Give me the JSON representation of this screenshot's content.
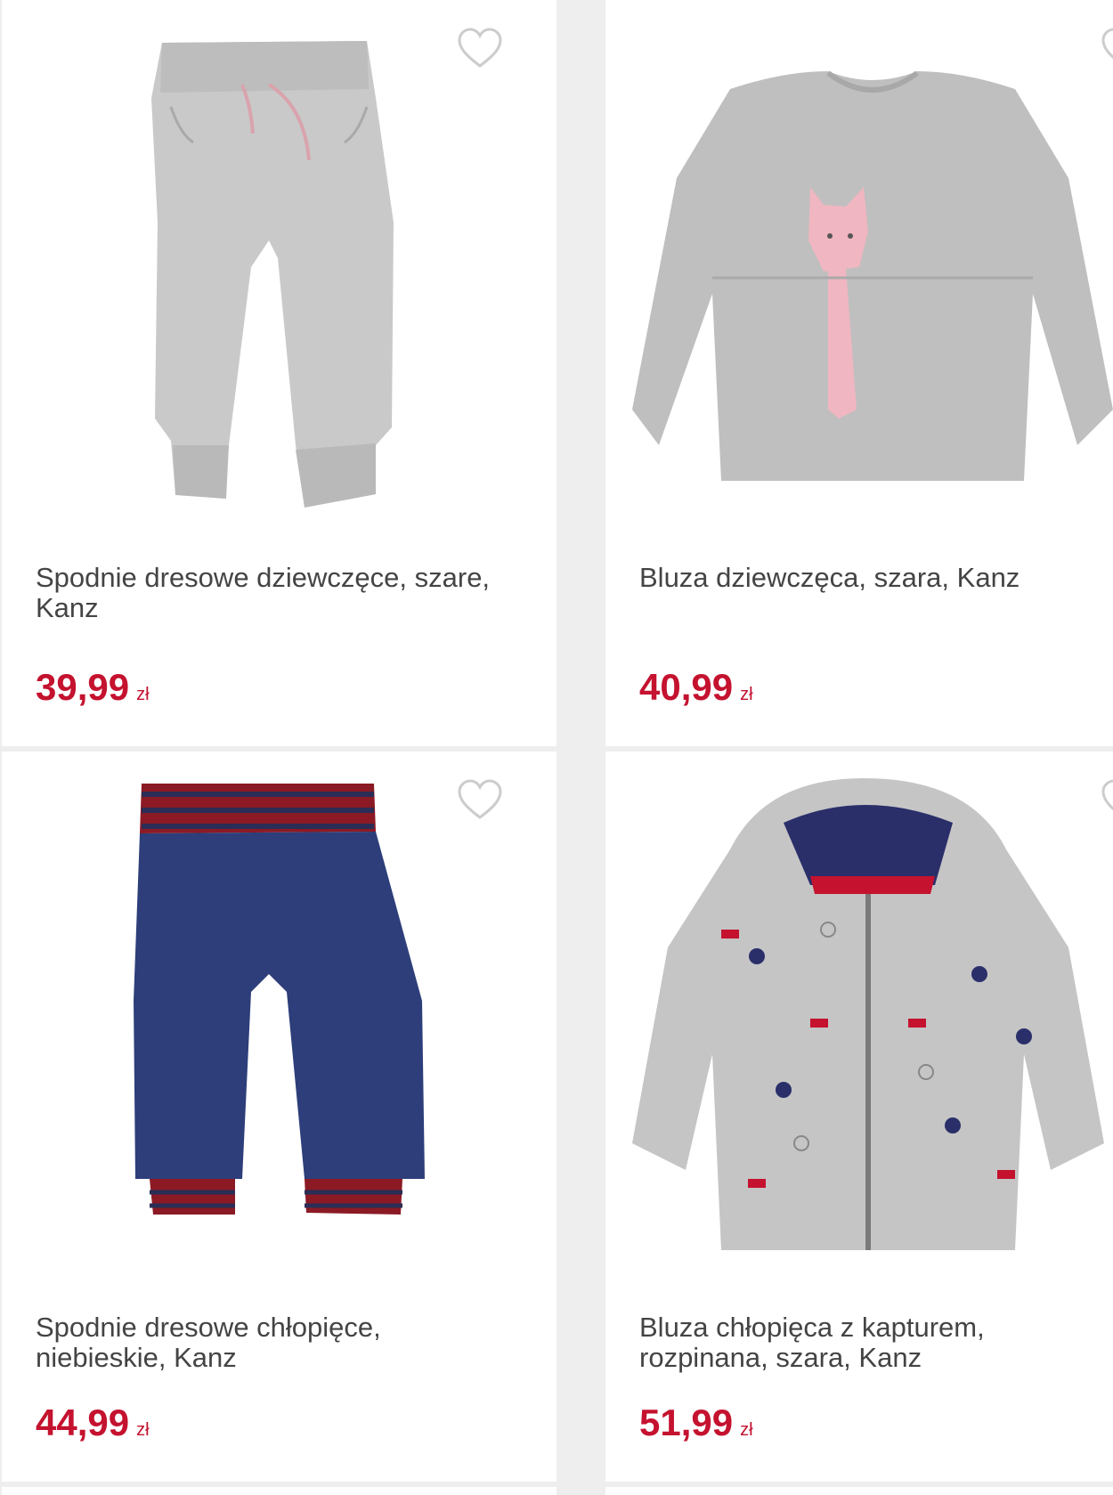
{
  "products": [
    {
      "title": "Spodnie dresowe dziewczęce, szare, Kanz",
      "price": "39,99",
      "currency": "zł",
      "image": "grey-girls-sweatpants"
    },
    {
      "title": "Bluza dziewczęca, szara, Kanz",
      "price": "40,99",
      "currency": "zł",
      "image": "grey-girls-sweatshirt-cat"
    },
    {
      "title": "Spodnie dresowe chłopięce, niebieskie, Kanz",
      "price": "44,99",
      "currency": "zł",
      "image": "blue-boys-sweatpants-striped"
    },
    {
      "title": "Bluza chłopięca z kapturem, rozpinana, szara, Kanz",
      "price": "51,99",
      "currency": "zł",
      "image": "grey-boys-zip-hoodie-print"
    }
  ],
  "colors": {
    "price": "#c4122f",
    "title": "#444444",
    "heart_outline": "#cccccc",
    "background": "#eeeeee"
  },
  "icons": {
    "favorite": "heart-outline-icon"
  }
}
